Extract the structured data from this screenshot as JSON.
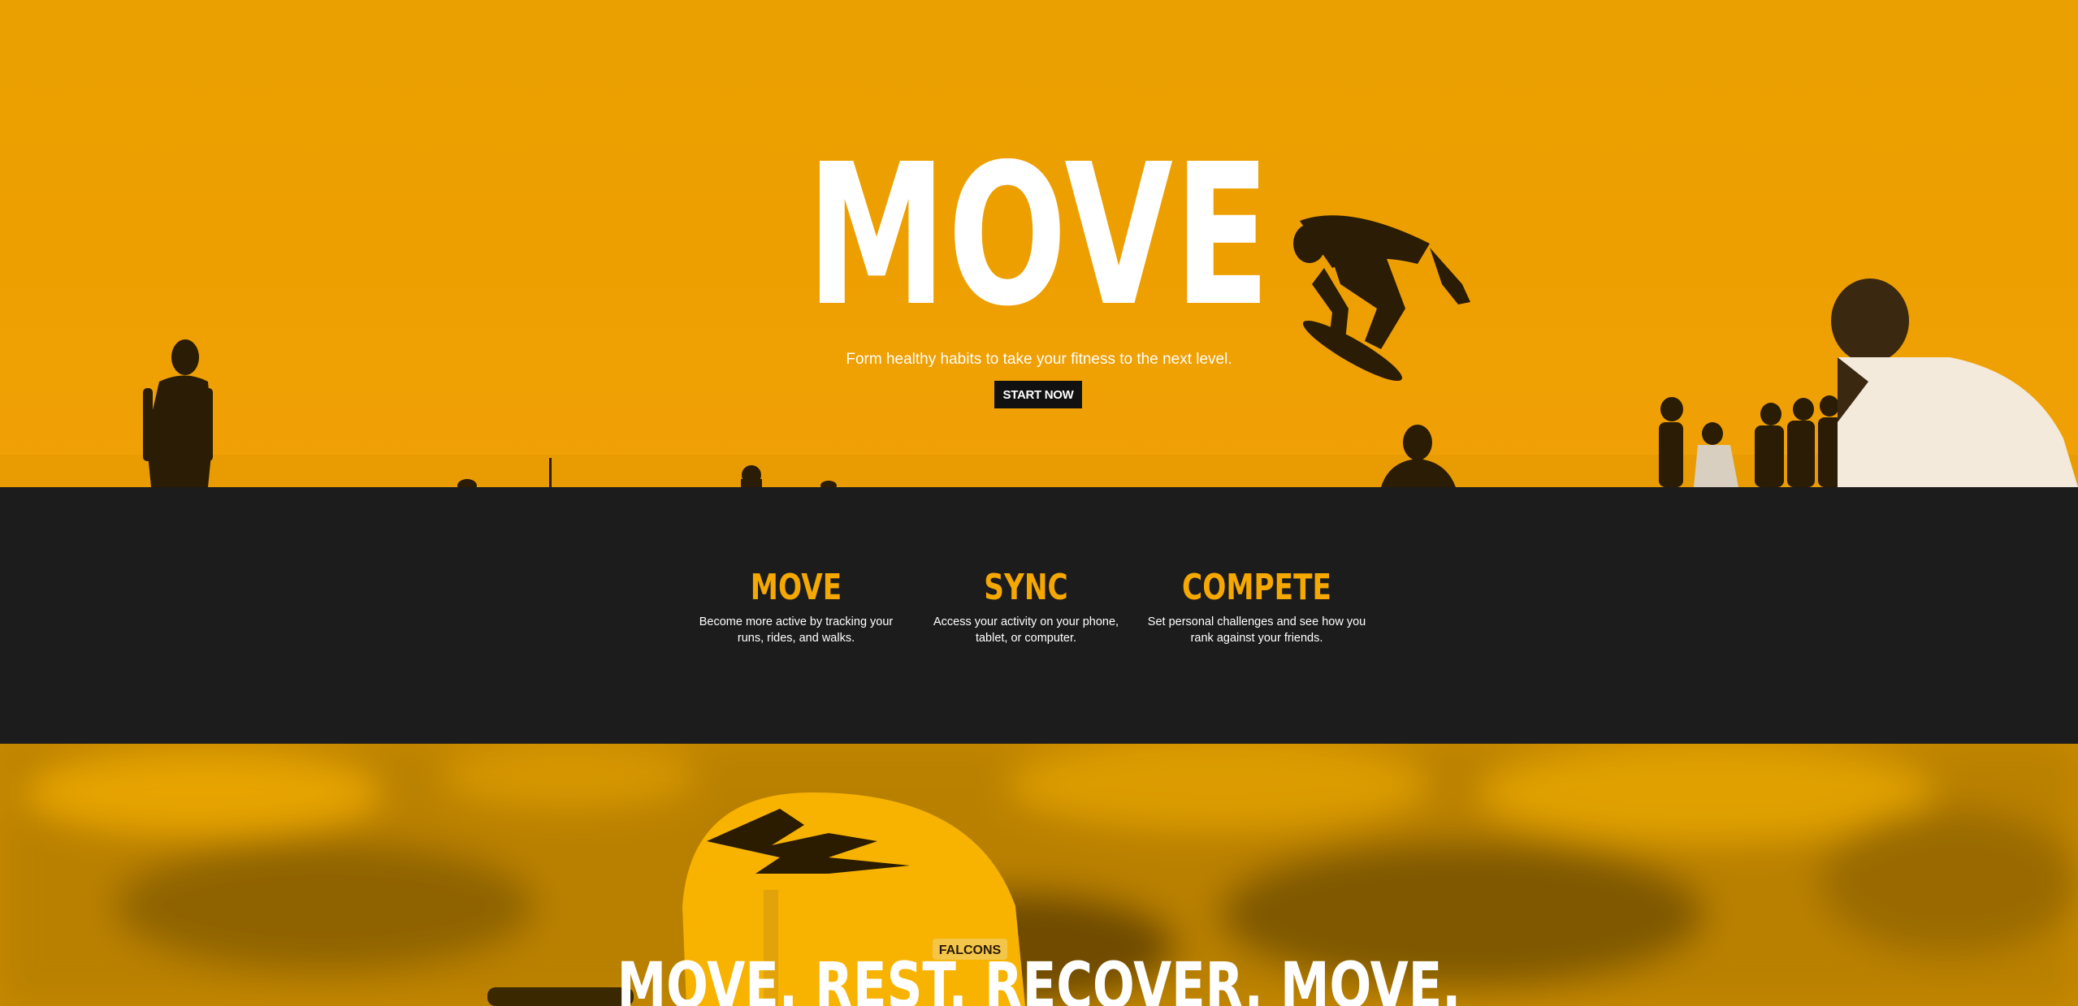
{
  "hero": {
    "title": "MOVE",
    "subtitle": "Form healthy habits to take your fitness to the next level.",
    "cta_label": "START NOW"
  },
  "features": [
    {
      "title": "MOVE",
      "text": "Become more active by tracking your runs, rides, and walks."
    },
    {
      "title": "SYNC",
      "text": "Access your activity on your phone, tablet, or computer."
    },
    {
      "title": "COMPETE",
      "text": "Set personal challenges and see how you rank against your friends."
    }
  ],
  "section2": {
    "title": "MOVE. REST. RECOVER. MOVE.",
    "helmet_text": "FALCONS"
  },
  "colors": {
    "accent": "#f5a800",
    "hero_bg": "#ee9f00",
    "dark_bg": "#1c1c1c",
    "button_bg": "#111111",
    "text_light": "#ffffff"
  }
}
